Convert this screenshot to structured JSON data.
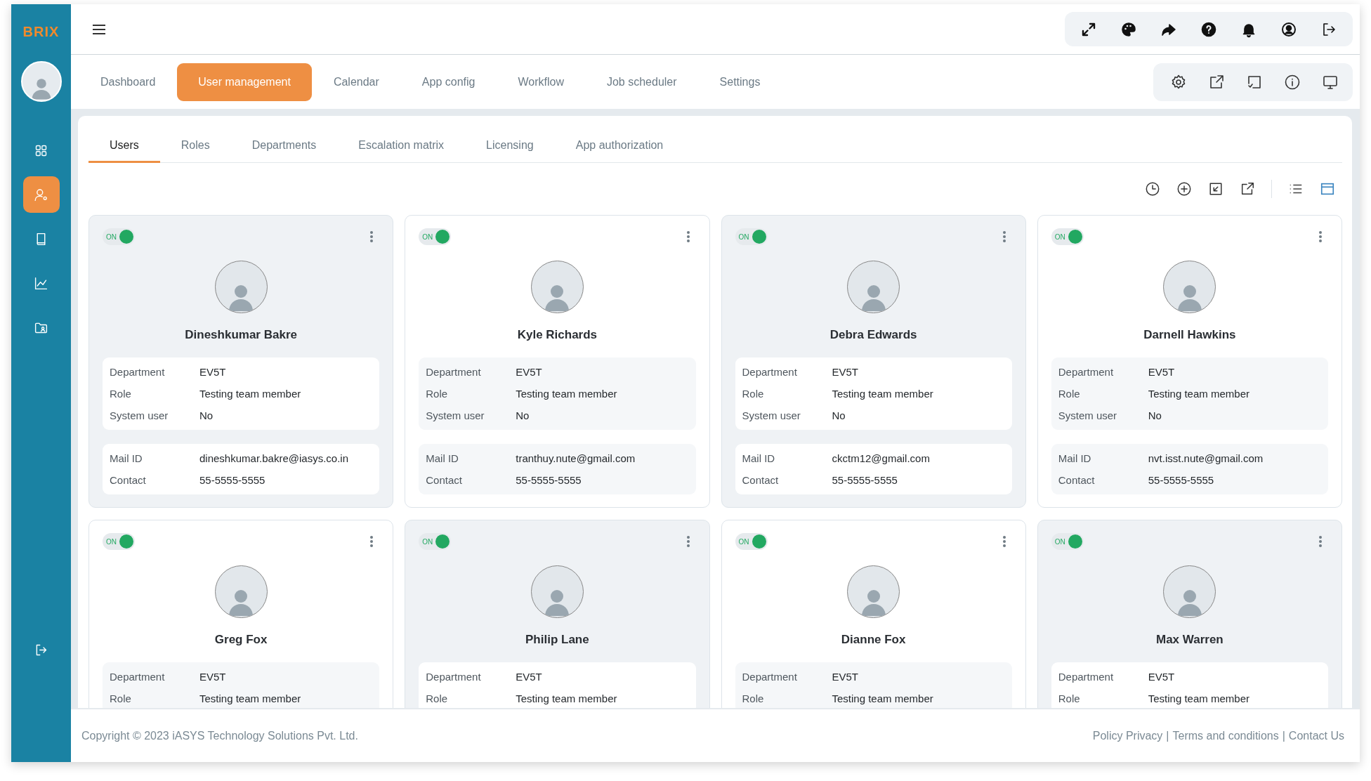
{
  "logo": "BRIX",
  "sidebar": {
    "items": [
      {
        "selected": false
      },
      {
        "selected": true
      },
      {
        "selected": false
      },
      {
        "selected": false
      },
      {
        "selected": false
      }
    ]
  },
  "nav_tabs": [
    {
      "label": "Dashboard",
      "selected": false
    },
    {
      "label": "User management",
      "selected": true
    },
    {
      "label": "Calendar",
      "selected": false
    },
    {
      "label": "App config",
      "selected": false
    },
    {
      "label": "Workflow",
      "selected": false
    },
    {
      "label": "Job scheduler",
      "selected": false
    },
    {
      "label": "Settings",
      "selected": false
    }
  ],
  "sub_tabs": [
    {
      "label": "Users",
      "selected": true
    },
    {
      "label": "Roles",
      "selected": false
    },
    {
      "label": "Departments",
      "selected": false
    },
    {
      "label": "Escalation matrix",
      "selected": false
    },
    {
      "label": "Licensing",
      "selected": false
    },
    {
      "label": "App authorization",
      "selected": false
    }
  ],
  "view_modes": [
    {
      "selected": false
    },
    {
      "selected": true
    }
  ],
  "users": [
    {
      "name": "Dineshkumar Bakre",
      "toggle_label": "ON",
      "on": true,
      "details": [
        {
          "label": "Department",
          "value": "EV5T"
        },
        {
          "label": "Role",
          "value": "Testing team member"
        },
        {
          "label": "System user",
          "value": "No"
        }
      ],
      "contacts": [
        {
          "label": "Mail ID",
          "value": "dineshkumar.bakre@iasys.co.in"
        },
        {
          "label": "Contact",
          "value": "55-5555-5555"
        }
      ]
    },
    {
      "name": "Kyle Richards",
      "toggle_label": "ON",
      "on": true,
      "details": [
        {
          "label": "Department",
          "value": "EV5T"
        },
        {
          "label": "Role",
          "value": "Testing team member"
        },
        {
          "label": "System user",
          "value": "No"
        }
      ],
      "contacts": [
        {
          "label": "Mail ID",
          "value": "tranthuy.nute@gmail.com"
        },
        {
          "label": "Contact",
          "value": "55-5555-5555"
        }
      ]
    },
    {
      "name": "Debra Edwards",
      "toggle_label": "ON",
      "on": true,
      "details": [
        {
          "label": "Department",
          "value": "EV5T"
        },
        {
          "label": "Role",
          "value": "Testing team member"
        },
        {
          "label": "System user",
          "value": "No"
        }
      ],
      "contacts": [
        {
          "label": "Mail ID",
          "value": "ckctm12@gmail.com"
        },
        {
          "label": "Contact",
          "value": "55-5555-5555"
        }
      ]
    },
    {
      "name": "Darnell Hawkins",
      "toggle_label": "ON",
      "on": true,
      "details": [
        {
          "label": "Department",
          "value": "EV5T"
        },
        {
          "label": "Role",
          "value": "Testing team member"
        },
        {
          "label": "System user",
          "value": "No"
        }
      ],
      "contacts": [
        {
          "label": "Mail ID",
          "value": "nvt.isst.nute@gmail.com"
        },
        {
          "label": "Contact",
          "value": "55-5555-5555"
        }
      ]
    },
    {
      "name": "Greg Fox",
      "toggle_label": "ON",
      "on": true,
      "details": [
        {
          "label": "Department",
          "value": "EV5T"
        },
        {
          "label": "Role",
          "value": "Testing team member"
        }
      ]
    },
    {
      "name": "Philip Lane",
      "toggle_label": "ON",
      "on": true,
      "details": [
        {
          "label": "Department",
          "value": "EV5T"
        },
        {
          "label": "Role",
          "value": "Testing team member"
        }
      ]
    },
    {
      "name": "Dianne Fox",
      "toggle_label": "ON",
      "on": true,
      "details": [
        {
          "label": "Department",
          "value": "EV5T"
        },
        {
          "label": "Role",
          "value": "Testing team member"
        }
      ]
    },
    {
      "name": "Max Warren",
      "toggle_label": "ON",
      "on": true,
      "details": [
        {
          "label": "Department",
          "value": "EV5T"
        },
        {
          "label": "Role",
          "value": "Testing team member"
        }
      ]
    }
  ],
  "footer": {
    "copyright": "Copyright © 2023  iASYS Technology Solutions Pvt. Ltd.",
    "separator": "|",
    "links": [
      "Policy Privacy",
      "Terms and conditions",
      "Contact Us"
    ]
  }
}
